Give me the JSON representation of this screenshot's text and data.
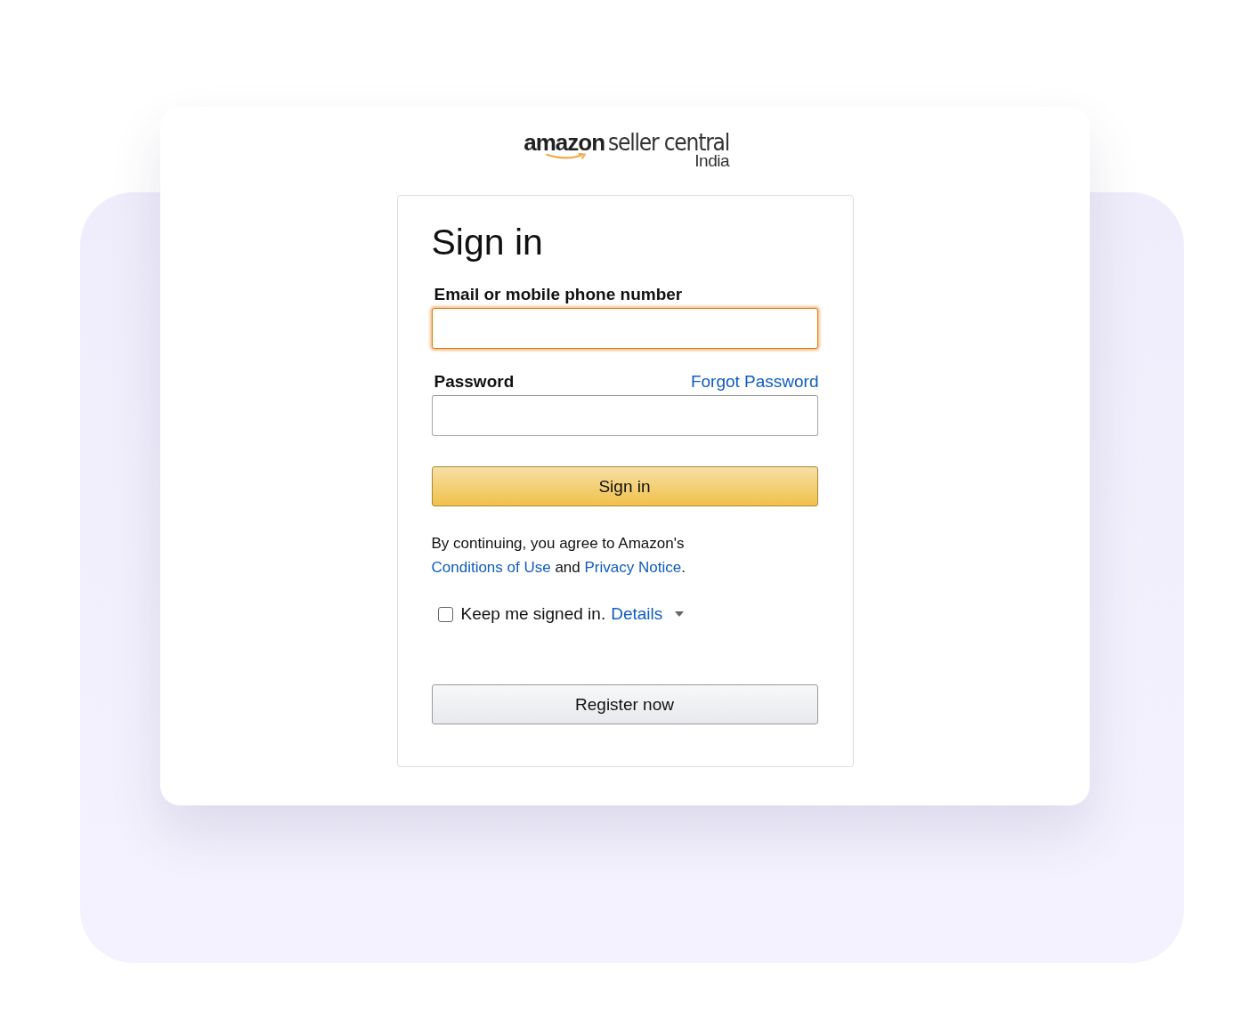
{
  "logo": {
    "brand": "amazon",
    "product": "seller central",
    "region": "India"
  },
  "form": {
    "title": "Sign in",
    "fields": [
      {
        "label": "Email or mobile phone number",
        "focused": true
      },
      {
        "label": "Password",
        "focused": false,
        "link": "Forgot Password"
      }
    ],
    "submit": "Sign in",
    "agreement": [
      {
        "kind": "text",
        "text": "By continuing, you agree to Amazon's "
      },
      {
        "kind": "link",
        "text": "Conditions of Use"
      },
      {
        "kind": "text",
        "text": " and "
      },
      {
        "kind": "link",
        "text": "Privacy Notice"
      },
      {
        "kind": "text",
        "text": "."
      }
    ],
    "keep_signed_in": {
      "label": "Keep me signed in.",
      "checked": false,
      "link": "Details"
    },
    "register": "Register now"
  }
}
